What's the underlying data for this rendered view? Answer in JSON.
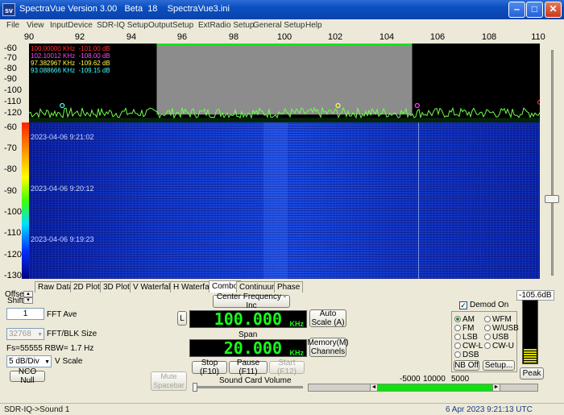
{
  "window": {
    "title": "SpectraVue Version 3.00   Beta  18    SpectraVue3.ini",
    "icon_text": "sv",
    "buttons": [
      "minimize-icon",
      "maximize-icon",
      "close-icon"
    ],
    "minimize_glyph": "‒",
    "maximize_glyph": "□",
    "close_glyph": "✕"
  },
  "menu": [
    "File",
    "View",
    "InputDevice",
    "SDR-IQ Setup",
    "OutputSetup",
    "ExtRadio Setup",
    "General Setup",
    "Help"
  ],
  "freq_axis": {
    "labels": [
      "90",
      "92",
      "94",
      "96",
      "98",
      "100",
      "102",
      "104",
      "106",
      "108",
      "110"
    ]
  },
  "spectrum": {
    "db_labels": [
      "-60",
      "-70",
      "-80",
      "-90",
      "-100",
      "-110",
      "-120"
    ],
    "db_range": [
      -125,
      -55
    ],
    "freq_range": [
      90,
      110
    ],
    "selection_mhz": [
      95.0,
      105.0
    ],
    "noise_floor_db": -118,
    "markers": [
      {
        "text": "100.00000 KHz  -101.00 dB",
        "color": "#ff3030"
      },
      {
        "text": "102.10012 KHz  -108.00 dB",
        "color": "#ff40ff"
      },
      {
        "text": "97.382967 KHz  -109.62 dB",
        "color": "#ffff40"
      },
      {
        "text": "93.088666 KHz  -109.15 dB",
        "color": "#40ffff"
      }
    ],
    "marker_points": [
      {
        "freq_mhz": 91.3,
        "db": -110,
        "color": "#40ffff"
      },
      {
        "freq_mhz": 102.1,
        "db": -110,
        "color": "#ffff40"
      },
      {
        "freq_mhz": 105.2,
        "db": -110,
        "color": "#ff40ff"
      },
      {
        "freq_mhz": 110.0,
        "db": -107,
        "color": "#ff3030"
      }
    ]
  },
  "waterfall": {
    "db_labels": [
      "-60",
      "-70",
      "-80",
      "-90",
      "-100",
      "-110",
      "-120",
      "-130"
    ],
    "timestamps": [
      "2023-04-06 9:21:02",
      "2023-04-06 9:20:12",
      "2023-04-06 9:19:23"
    ]
  },
  "tabs": [
    "Raw Data",
    "2D Plot",
    "3D Plot",
    "V Waterfall",
    "H Waterfall",
    "Combo",
    "Continuum",
    "Phase"
  ],
  "active_tab": "Combo",
  "controls": {
    "offset_label": "Offset",
    "shift_label": "Shift",
    "spin_up": "▲",
    "spin_down": "▼",
    "dropdown_glyph": "▼",
    "fft_ave_value": "1",
    "fft_ave_label": "FFT Ave",
    "fft_size_value": "32768",
    "fft_size_label": "FFT/BLK Size",
    "fs_text": "Fs=55555 RBW= 1.7 Hz",
    "vscale_value": "5 dB/Div",
    "vscale_label": "V Scale",
    "nco_null": "NCO Null",
    "mute_label": "Mute Spacebar",
    "center_freq_btn": "Center Frequency - Inc",
    "l_btn": "L",
    "center_freq_value": "100.000",
    "center_freq_unit": "KHz",
    "autoscale_btn": "Auto Scale (A)",
    "span_label": "Span",
    "span_value": "20.000",
    "span_unit": "KHz",
    "memory_btn": "Memory(M) Channels",
    "stop_btn": "Stop (F10)",
    "pause_btn": "Pause (F11)",
    "start_btn": "Start (F12)",
    "sound_card_volume": "Sound Card Volume",
    "scale_labels": [
      "-5000",
      "10000",
      "5000"
    ],
    "scroll_left": "◄",
    "scroll_right": "►"
  },
  "demod": {
    "label": "Demod On",
    "checked": true,
    "check_glyph": "✓",
    "modes_left": [
      "AM",
      "FM",
      "LSB",
      "CW-L",
      "DSB"
    ],
    "modes_right": [
      "WFM",
      "W/USB",
      "USB",
      "CW-U"
    ],
    "selected": "AM",
    "nb_off": "NB Off",
    "setup": "Setup..."
  },
  "meter": {
    "db_value": "-105.6dB",
    "peak_btn": "Peak",
    "level_fraction": 0.22
  },
  "status": {
    "left": "SDR-IQ->Sound 1",
    "right": "6 Apr 2023  9:21:13 UTC"
  },
  "colors": {
    "lcd_green": "#18ff18",
    "trace_green": "#6dff4a",
    "selection_gray": "#8c8c8c",
    "selection_bar": "#19e019"
  }
}
